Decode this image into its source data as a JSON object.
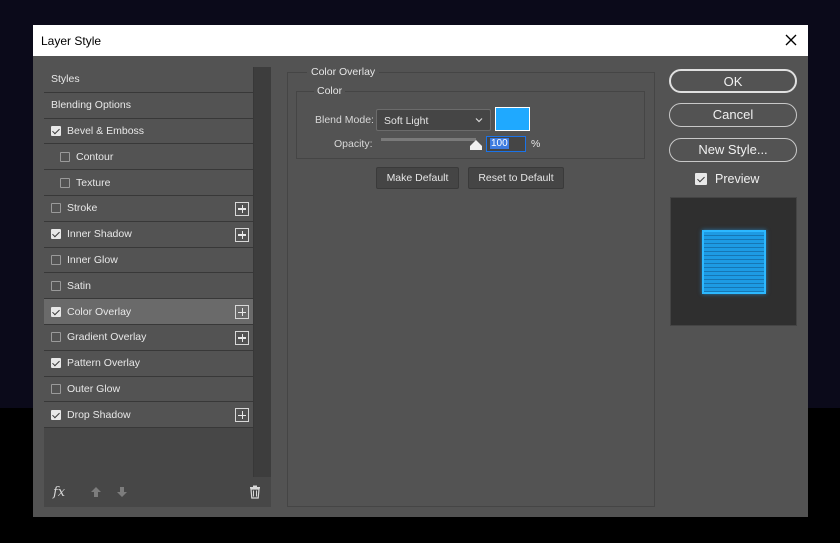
{
  "dialog": {
    "title": "Layer Style"
  },
  "styles_list": {
    "items": [
      {
        "label": "Styles",
        "type": "header",
        "checked": null,
        "has_plus": false,
        "selected": false
      },
      {
        "label": "Blending Options",
        "type": "header",
        "checked": null,
        "has_plus": false,
        "selected": false
      },
      {
        "label": "Bevel & Emboss",
        "type": "item",
        "checked": true,
        "has_plus": false,
        "selected": false
      },
      {
        "label": "Contour",
        "type": "sub",
        "checked": false,
        "has_plus": false,
        "selected": false
      },
      {
        "label": "Texture",
        "type": "sub",
        "checked": false,
        "has_plus": false,
        "selected": false
      },
      {
        "label": "Stroke",
        "type": "item",
        "checked": false,
        "has_plus": true,
        "selected": false
      },
      {
        "label": "Inner Shadow",
        "type": "item",
        "checked": true,
        "has_plus": true,
        "selected": false
      },
      {
        "label": "Inner Glow",
        "type": "item",
        "checked": false,
        "has_plus": false,
        "selected": false
      },
      {
        "label": "Satin",
        "type": "item",
        "checked": false,
        "has_plus": false,
        "selected": false
      },
      {
        "label": "Color Overlay",
        "type": "item",
        "checked": true,
        "has_plus": true,
        "selected": true
      },
      {
        "label": "Gradient Overlay",
        "type": "item",
        "checked": false,
        "has_plus": true,
        "selected": false
      },
      {
        "label": "Pattern Overlay",
        "type": "item",
        "checked": true,
        "has_plus": false,
        "selected": false
      },
      {
        "label": "Outer Glow",
        "type": "item",
        "checked": false,
        "has_plus": false,
        "selected": false
      },
      {
        "label": "Drop Shadow",
        "type": "item",
        "checked": true,
        "has_plus": true,
        "selected": false
      }
    ],
    "footer": {
      "fx_label": "fx"
    }
  },
  "color_overlay": {
    "section_title": "Color Overlay",
    "group_title": "Color",
    "blend_mode_label": "Blend Mode:",
    "blend_mode_value": "Soft Light",
    "overlay_color": "#1fa9ff",
    "opacity_label": "Opacity:",
    "opacity_value": "100",
    "opacity_unit": "%",
    "make_default_label": "Make Default",
    "reset_default_label": "Reset to Default"
  },
  "actions": {
    "ok_label": "OK",
    "cancel_label": "Cancel",
    "new_style_label": "New Style...",
    "preview_label": "Preview",
    "preview_checked": true
  }
}
